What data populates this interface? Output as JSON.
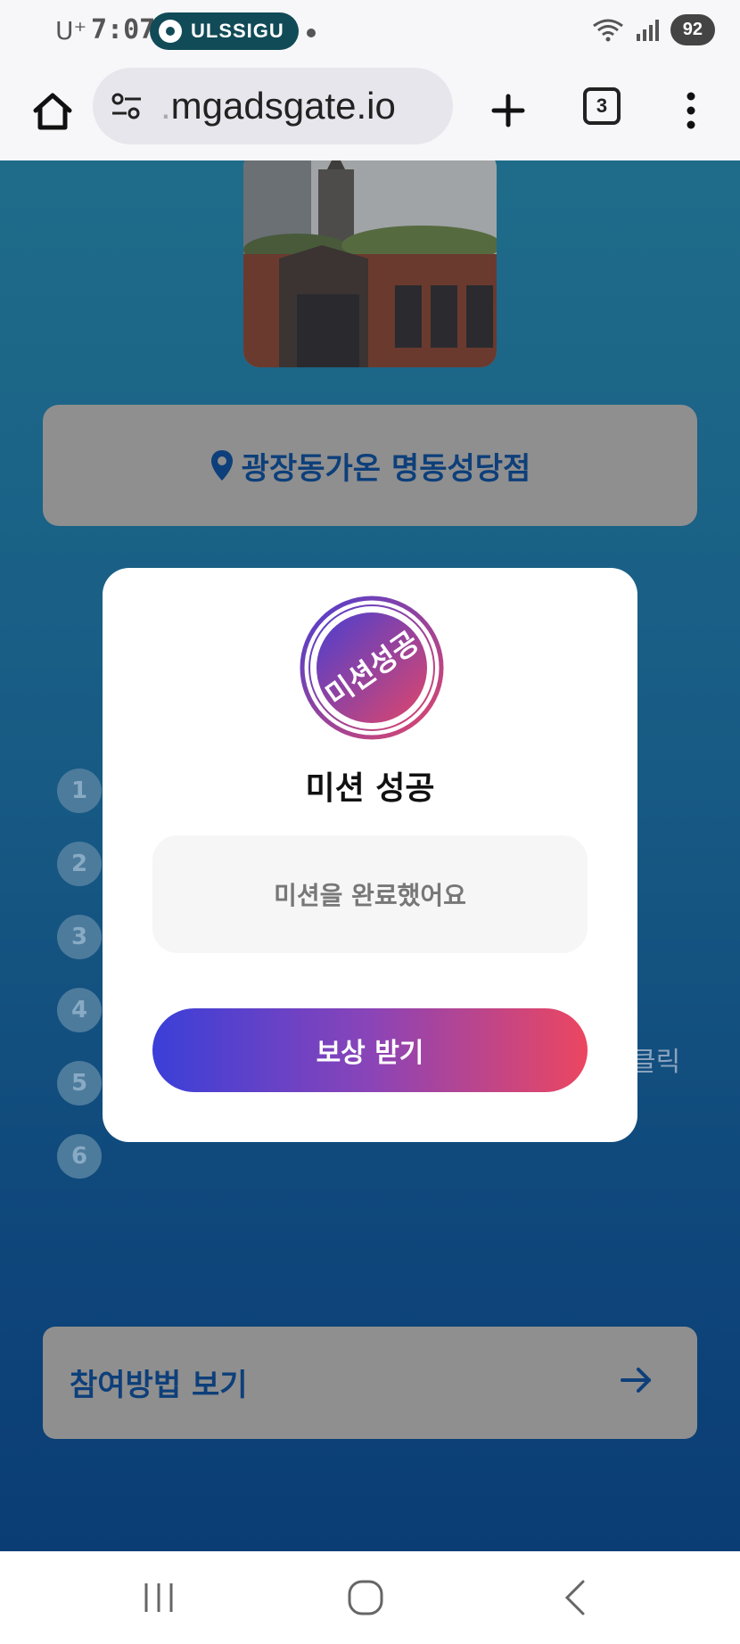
{
  "status_bar": {
    "carrier": "U⁺",
    "time": "7:07",
    "app_pill": "ULSSIGU",
    "battery": "92"
  },
  "browser": {
    "url_prefix": ".",
    "url": "mgadsgate.io",
    "tab_count": "3",
    "icons": [
      "home-icon",
      "tune-icon",
      "plus-icon",
      "more-vert-icon"
    ]
  },
  "page": {
    "location": "광장동가온 명동성당점",
    "steps": [
      "1",
      "2",
      "3",
      "4",
      "5",
      "6"
    ],
    "step_tail_text": "클릭",
    "howto_label": "참여방법 보기"
  },
  "modal": {
    "stamp_text": "미션성공",
    "title": "미션 성공",
    "message": "미션을 완료했어요",
    "button_label": "보상 받기"
  },
  "colors": {
    "brand_blue": "#0d3f7a",
    "gradient_start": "#3a3fd8",
    "gradient_end": "#ec4660"
  }
}
